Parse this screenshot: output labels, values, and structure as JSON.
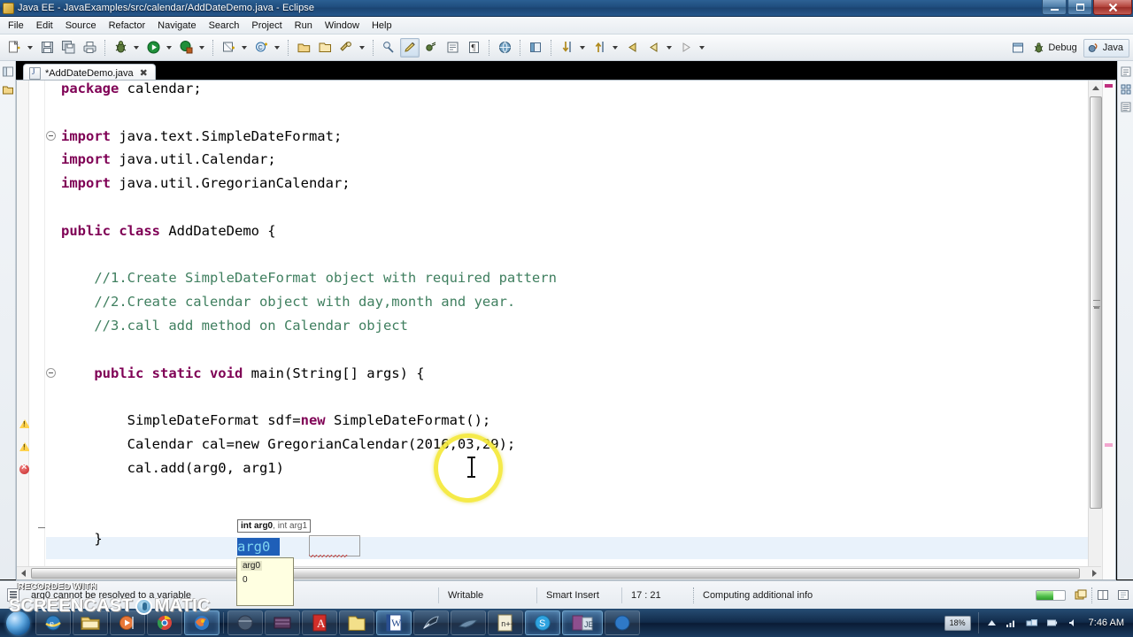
{
  "window": {
    "title": "Java EE - JavaExamples/src/calendar/AddDateDemo.java - Eclipse",
    "minimize_label": "Minimize",
    "maximize_label": "Maximize",
    "close_label": "Close"
  },
  "menubar": {
    "items": [
      {
        "label": "File"
      },
      {
        "label": "Edit"
      },
      {
        "label": "Source"
      },
      {
        "label": "Refactor"
      },
      {
        "label": "Navigate"
      },
      {
        "label": "Search"
      },
      {
        "label": "Project"
      },
      {
        "label": "Run"
      },
      {
        "label": "Window"
      },
      {
        "label": "Help"
      }
    ]
  },
  "toolbar": {
    "buttons": [
      {
        "name": "new-wizard",
        "icon": "new-file-icon",
        "dropdown": true
      },
      {
        "name": "save",
        "icon": "save-icon",
        "dropdown": false
      },
      {
        "name": "save-all",
        "icon": "save-all-icon",
        "dropdown": false
      },
      {
        "name": "print",
        "icon": "print-icon",
        "dropdown": false
      },
      {
        "name": "debug",
        "icon": "debug-bug-icon",
        "dropdown": true
      },
      {
        "name": "run",
        "icon": "run-play-icon",
        "dropdown": true
      },
      {
        "name": "run-external-tools",
        "icon": "external-tools-icon",
        "dropdown": true
      },
      {
        "name": "new-java-project",
        "icon": "new-java-project-icon",
        "dropdown": true
      },
      {
        "name": "new-class",
        "icon": "new-class-icon",
        "dropdown": true
      },
      {
        "name": "open-type",
        "icon": "open-type-icon",
        "dropdown": false
      },
      {
        "name": "open-task",
        "icon": "open-task-icon",
        "dropdown": false
      },
      {
        "name": "search",
        "icon": "search-icon",
        "dropdown": true
      },
      {
        "name": "link-helper",
        "icon": "link-icon",
        "dropdown": false
      },
      {
        "name": "toggle-mark-occurrences",
        "icon": "highlight-pen-icon",
        "dropdown": false,
        "pressed": true
      },
      {
        "name": "skip-breakpoints",
        "icon": "skip-breakpoints-icon",
        "dropdown": false
      },
      {
        "name": "toggle-block-selection",
        "icon": "block-selection-icon",
        "dropdown": false
      },
      {
        "name": "show-whitespace",
        "icon": "pilcrow-icon",
        "dropdown": false
      },
      {
        "name": "open-web-browser",
        "icon": "globe-icon",
        "dropdown": false
      },
      {
        "name": "open-perspective-dialog",
        "icon": "perspective-icon",
        "dropdown": false
      },
      {
        "name": "next-annotation",
        "icon": "next-annotation-icon",
        "dropdown": true
      },
      {
        "name": "previous-annotation",
        "icon": "previous-annotation-icon",
        "dropdown": true
      },
      {
        "name": "back",
        "icon": "back-arrow-icon",
        "dropdown": false
      },
      {
        "name": "forward",
        "icon": "forward-arrow-icon",
        "dropdown": true
      },
      {
        "name": "last-edit-location",
        "icon": "last-edit-arrow-icon",
        "dropdown": true
      }
    ],
    "perspectives": {
      "open_perspective_label": "Open Perspective",
      "items": [
        {
          "label": "Debug",
          "icon": "debug-bug-icon",
          "active": false
        },
        {
          "label": "Java",
          "icon": "java-perspective-icon",
          "active": true
        }
      ]
    }
  },
  "editor": {
    "tab": {
      "label": "*AddDateDemo.java",
      "dirty_marker": "*",
      "close_label": "✖",
      "icon": "java-file-icon"
    },
    "code_lines": [
      {
        "indent": 0,
        "tokens": [
          {
            "t": "package ",
            "c": "kw"
          },
          {
            "t": "calendar;",
            "c": "plain"
          }
        ]
      },
      {
        "indent": 0,
        "tokens": []
      },
      {
        "indent": 0,
        "tokens": [
          {
            "t": "import ",
            "c": "kw"
          },
          {
            "t": "java.text.SimpleDateFormat;",
            "c": "plain"
          }
        ]
      },
      {
        "indent": 0,
        "tokens": [
          {
            "t": "import ",
            "c": "kw"
          },
          {
            "t": "java.util.Calendar;",
            "c": "plain"
          }
        ]
      },
      {
        "indent": 0,
        "tokens": [
          {
            "t": "import ",
            "c": "kw"
          },
          {
            "t": "java.util.GregorianCalendar;",
            "c": "plain"
          }
        ]
      },
      {
        "indent": 0,
        "tokens": []
      },
      {
        "indent": 0,
        "tokens": [
          {
            "t": "public class ",
            "c": "kw"
          },
          {
            "t": "AddDateDemo {",
            "c": "plain"
          }
        ]
      },
      {
        "indent": 0,
        "tokens": []
      },
      {
        "indent": 1,
        "tokens": [
          {
            "t": "//1.Create SimpleDateFormat object with required pattern",
            "c": "cmt"
          }
        ]
      },
      {
        "indent": 1,
        "tokens": [
          {
            "t": "//2.Create calendar object with day,month and year.",
            "c": "cmt"
          }
        ]
      },
      {
        "indent": 1,
        "tokens": [
          {
            "t": "//3.call add method on Calendar object",
            "c": "cmt"
          }
        ]
      },
      {
        "indent": 0,
        "tokens": []
      },
      {
        "indent": 1,
        "tokens": [
          {
            "t": "public static void ",
            "c": "kw"
          },
          {
            "t": "main(String[] args) {",
            "c": "plain"
          }
        ]
      },
      {
        "indent": 0,
        "tokens": []
      },
      {
        "indent": 2,
        "tokens": [
          {
            "t": "SimpleDateFormat sdf=",
            "c": "plain"
          },
          {
            "t": "new",
            "c": "kw"
          },
          {
            "t": " SimpleDateFormat();",
            "c": "plain"
          }
        ]
      },
      {
        "indent": 2,
        "tokens": [
          {
            "t": "Calendar cal=new GregorianCalendar(2016,03,29);",
            "c": "plain"
          }
        ]
      },
      {
        "indent": 2,
        "tokens": [
          {
            "t": "cal.add(arg0, arg1)",
            "c": "plain"
          }
        ]
      },
      {
        "indent": 0,
        "tokens": []
      },
      {
        "indent": 0,
        "tokens": []
      },
      {
        "indent": 1,
        "tokens": [
          {
            "t": "}",
            "c": "plain"
          }
        ]
      }
    ],
    "param_tooltip": {
      "active_param": "int arg0",
      "separator": ", ",
      "next_param": "int arg1"
    },
    "selected_token": "arg0",
    "second_token": "arg1",
    "value_popup": {
      "name": "arg0",
      "value": "0"
    },
    "gutter_markers": [
      {
        "type": "warning",
        "name": "warning-marker"
      },
      {
        "type": "warning",
        "name": "warning-marker"
      },
      {
        "type": "error",
        "name": "error-marker"
      }
    ]
  },
  "statusbar": {
    "message_text": "arg0 cannot be resolved to a variable",
    "writable": "Writable",
    "insert_mode": "Smart Insert",
    "cursor_position": "17 : 21",
    "task_text": "Computing additional info",
    "progress_percent": 60
  },
  "watermark": {
    "recorded_with": "RECORDED WITH",
    "brand_left": "SCREENCAST",
    "brand_right": "MATIC"
  },
  "taskbar": {
    "start_label": "Start",
    "items": [
      {
        "name": "taskbar-windows-explorer-orb",
        "icon": "explorer-globe-icon"
      },
      {
        "name": "taskbar-internet-explorer",
        "icon": "internet-explorer-icon"
      },
      {
        "name": "taskbar-file-explorer",
        "icon": "folder-icon"
      },
      {
        "name": "taskbar-media-player",
        "icon": "media-player-icon"
      },
      {
        "name": "taskbar-chrome",
        "icon": "chrome-icon"
      },
      {
        "name": "taskbar-firefox",
        "icon": "firefox-icon",
        "running": true
      },
      {
        "name": "taskbar-disc-tool",
        "icon": "disc-icon"
      },
      {
        "name": "taskbar-photo-viewer",
        "icon": "photos-icon"
      },
      {
        "name": "taskbar-adobe-reader",
        "icon": "adobe-reader-icon"
      },
      {
        "name": "taskbar-notes",
        "icon": "notes-folder-icon"
      },
      {
        "name": "taskbar-word",
        "icon": "word-icon",
        "running": true
      },
      {
        "name": "taskbar-tool-dish",
        "icon": "satellite-icon"
      },
      {
        "name": "taskbar-shark-app",
        "icon": "shark-icon"
      },
      {
        "name": "taskbar-cpp-ide",
        "icon": "cpp-icon"
      },
      {
        "name": "taskbar-skype",
        "icon": "skype-icon",
        "running": true
      },
      {
        "name": "taskbar-eclipse",
        "icon": "eclipse-icon",
        "running": true
      },
      {
        "name": "taskbar-browser-2",
        "icon": "browser-icon"
      }
    ],
    "tray": {
      "cpu_badge": "18%",
      "icons": [
        {
          "name": "tray-show-hidden-icon",
          "glyph": "▲"
        },
        {
          "name": "tray-signal-icon",
          "glyph": "signal"
        },
        {
          "name": "tray-network-icon",
          "glyph": "network"
        },
        {
          "name": "tray-volume-icon",
          "glyph": "volume"
        },
        {
          "name": "tray-battery-icon",
          "glyph": "battery"
        }
      ],
      "clock": "7:46 AM"
    }
  }
}
